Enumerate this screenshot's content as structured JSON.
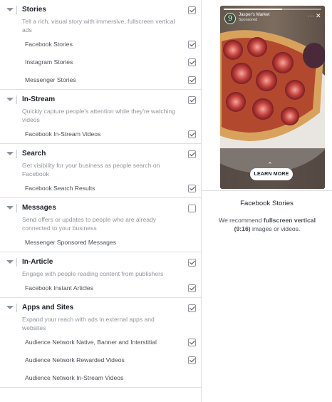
{
  "sections": [
    {
      "title": "Stories",
      "checked": true,
      "description": "Tell a rich, visual story with immersive, fullscreen vertical ads",
      "items": [
        {
          "label": "Facebook Stories",
          "checked": true
        },
        {
          "label": "Instagram Stories",
          "checked": true
        },
        {
          "label": "Messenger Stories",
          "checked": true
        }
      ]
    },
    {
      "title": "In-Stream",
      "checked": true,
      "description": "Quickly capture people's attention while they're watching videos",
      "items": [
        {
          "label": "Facebook In-Stream Videos",
          "checked": true
        }
      ]
    },
    {
      "title": "Search",
      "checked": true,
      "description": "Get visibility for your business as people search on Facebook",
      "items": [
        {
          "label": "Facebook Search Results",
          "checked": true
        }
      ]
    },
    {
      "title": "Messages",
      "checked": false,
      "description": "Send offers or updates to people who are already connected to your business",
      "items": [
        {
          "label": "Messenger Sponsored Messages",
          "checked": false
        }
      ]
    },
    {
      "title": "In-Article",
      "checked": true,
      "description": "Engage with people reading content from publishers",
      "items": [
        {
          "label": "Facebook Instant Articles",
          "checked": true
        }
      ]
    },
    {
      "title": "Apps and Sites",
      "checked": true,
      "description": "Expand your reach with ads in external apps and websites",
      "items": [
        {
          "label": "Audience Network Native, Banner and Interstitial",
          "checked": true
        },
        {
          "label": "Audience Network Rewarded Videos",
          "checked": true
        },
        {
          "label": "Audience Network In-Stream Videos",
          "checked": false
        }
      ]
    }
  ],
  "preview": {
    "brand_initial": "9",
    "brand_name": "Jasper's Market",
    "brand_sub": "Sponsored",
    "more_icon": "ellipsis-icon",
    "close_icon": "close-icon",
    "cta_label": "LEARN MORE",
    "title": "Facebook Stories",
    "note_prefix": "We recommend ",
    "note_bold": "fullscreen vertical (9:16)",
    "note_suffix": " images or videos."
  }
}
